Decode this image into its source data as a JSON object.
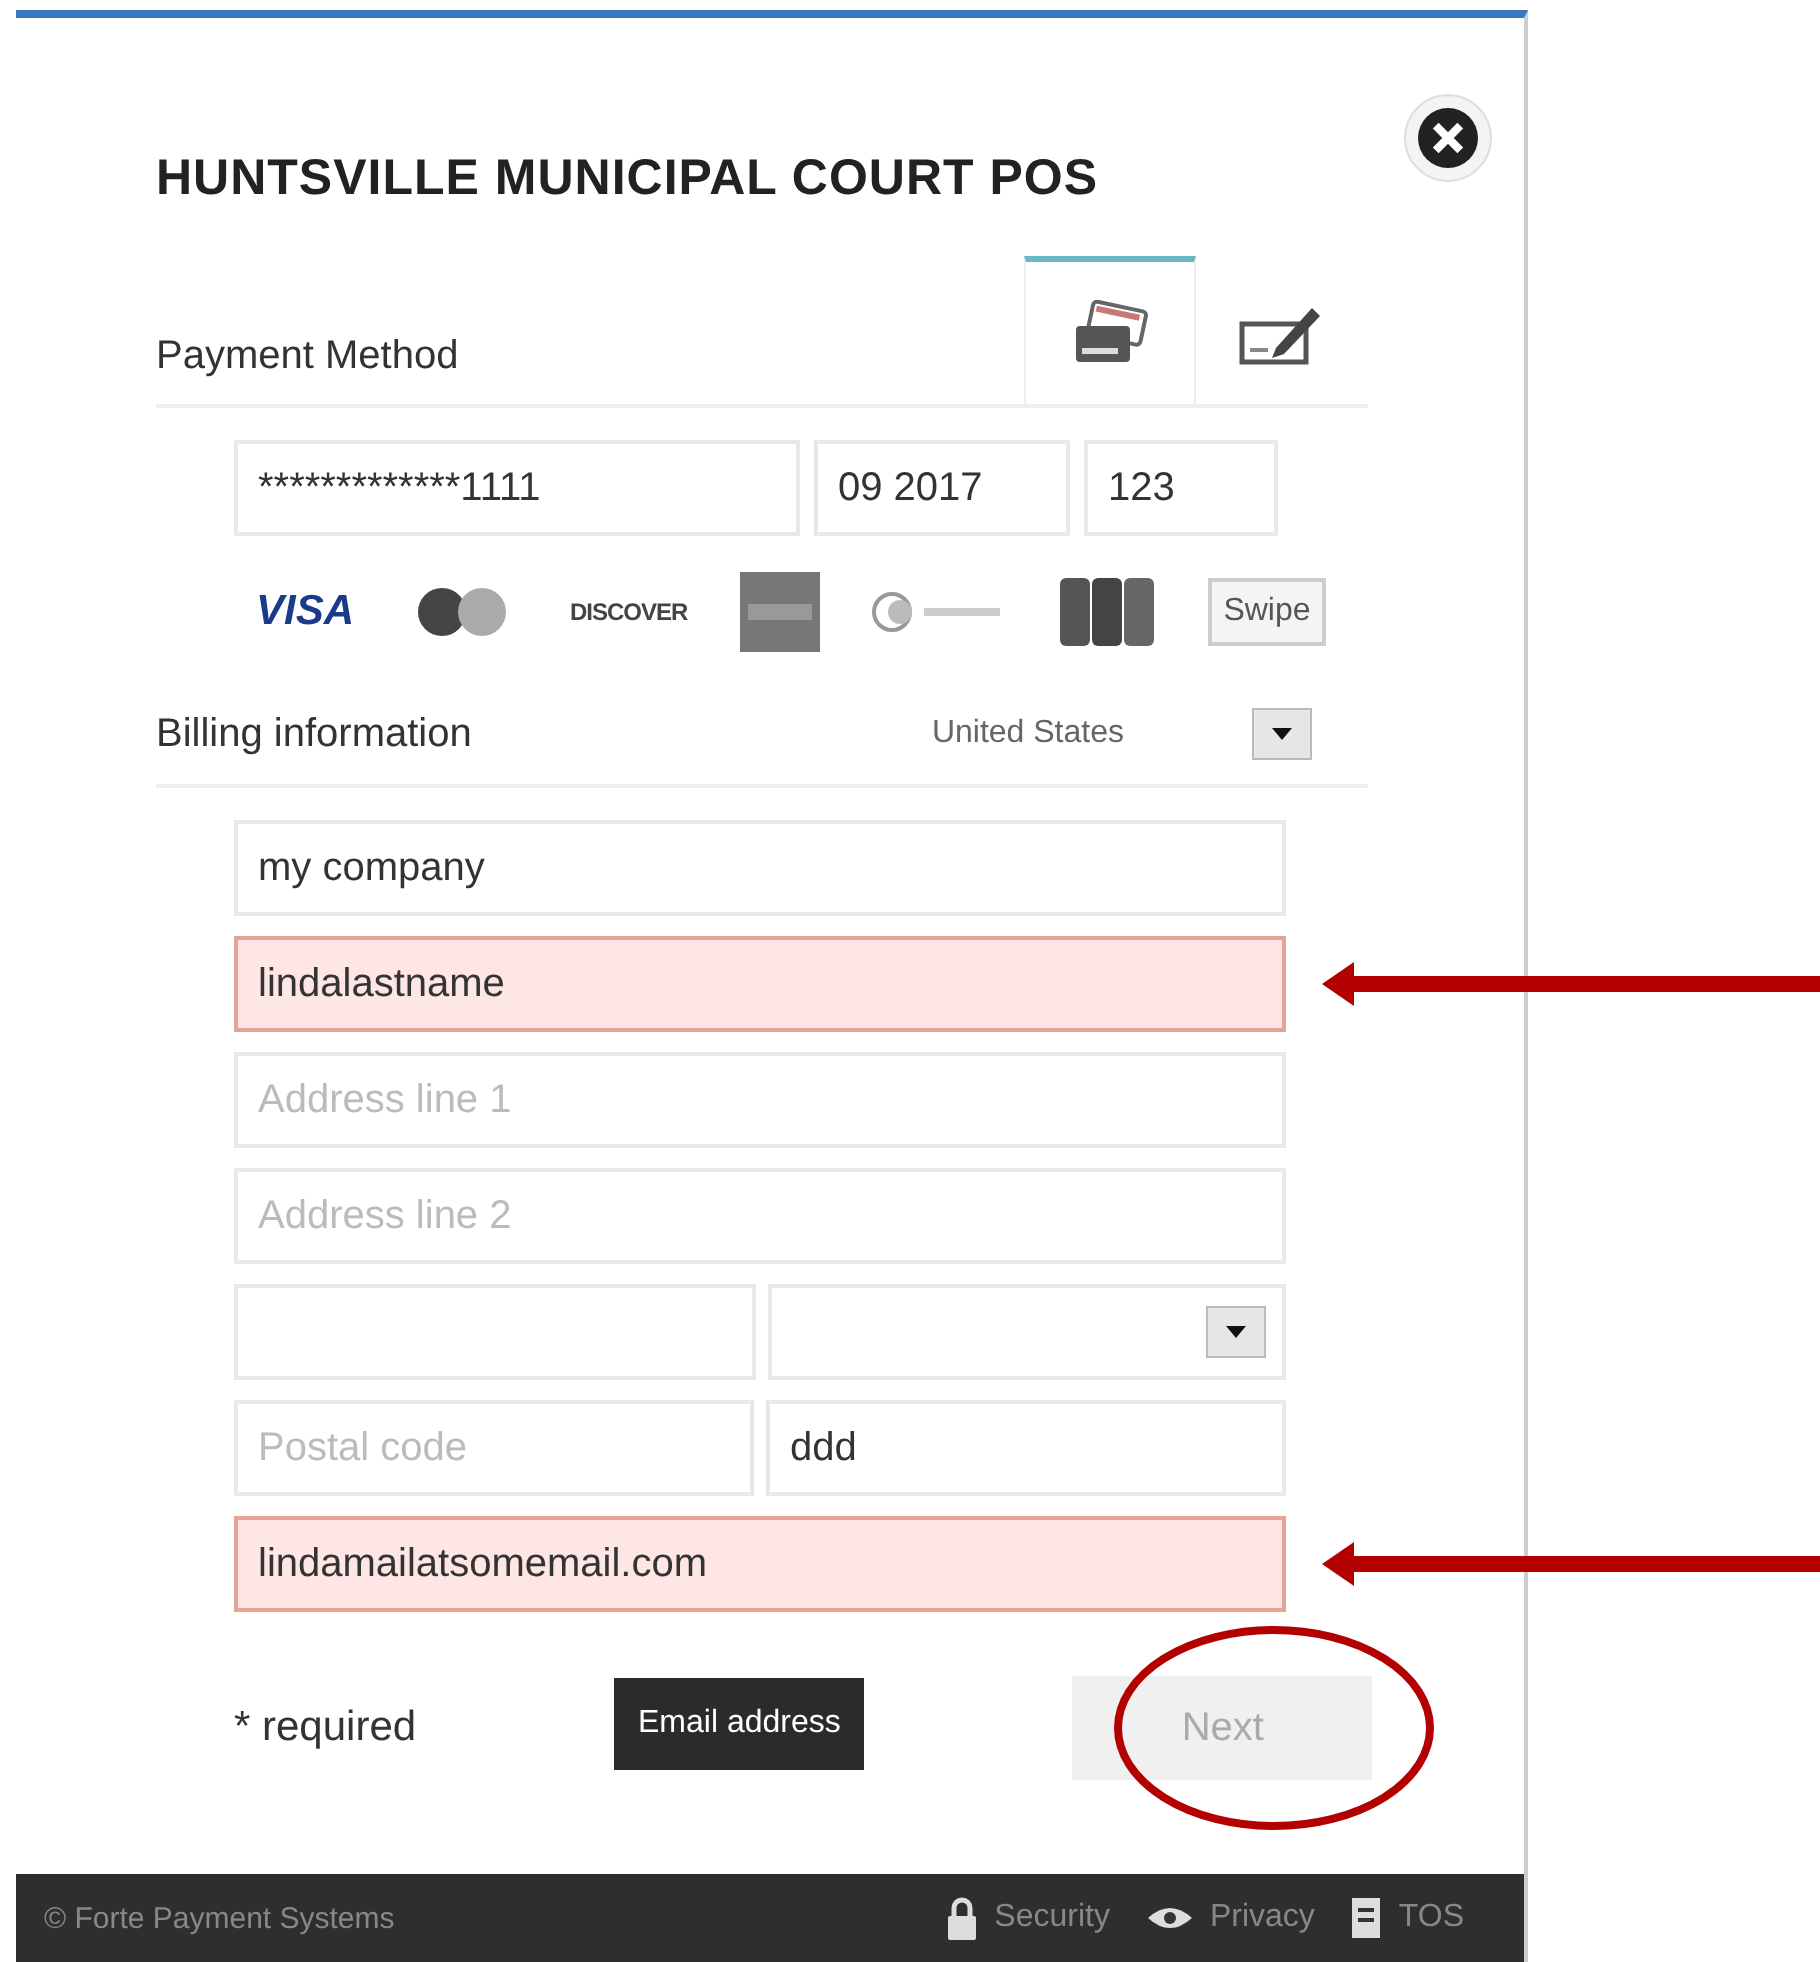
{
  "title": "HUNTSVILLE MUNICIPAL COURT POS",
  "payment_method": {
    "label": "Payment Method",
    "tabs": [
      {
        "kind": "card",
        "selected": true
      },
      {
        "kind": "check",
        "selected": false
      }
    ]
  },
  "card": {
    "number": "*************1111",
    "expiry": "09 2017",
    "cvv": "123"
  },
  "brands": [
    {
      "kind": "visa",
      "label": "VISA"
    },
    {
      "kind": "mastercard"
    },
    {
      "kind": "discover",
      "label": "DISCOVER"
    },
    {
      "kind": "amex"
    },
    {
      "kind": "diners"
    },
    {
      "kind": "jcb"
    }
  ],
  "swipe": "Swipe",
  "billing": {
    "label": "Billing information",
    "country": "United States"
  },
  "rows": [
    {
      "arrow": false,
      "fields": [
        {
          "kind": "text",
          "value": "my company",
          "invalid": false
        }
      ]
    },
    {
      "arrow": true,
      "fields": [
        {
          "kind": "text",
          "value": "lindalastname",
          "invalid": true
        }
      ]
    },
    {
      "arrow": false,
      "fields": [
        {
          "kind": "text",
          "placeholder": "Address line 1",
          "invalid": false
        }
      ]
    },
    {
      "arrow": false,
      "fields": [
        {
          "kind": "text",
          "placeholder": "Address line 2",
          "invalid": false
        }
      ]
    },
    {
      "arrow": false,
      "fields": [
        {
          "kind": "text",
          "invalid": false
        },
        {
          "kind": "select",
          "invalid": false
        }
      ]
    },
    {
      "arrow": false,
      "fields": [
        {
          "kind": "text",
          "placeholder": "Postal code",
          "invalid": false
        },
        {
          "kind": "text",
          "value": "ddd",
          "invalid": false
        }
      ]
    },
    {
      "arrow": true,
      "fields": [
        {
          "kind": "text",
          "value": "lindamailatsomemail.com",
          "invalid": true
        }
      ]
    }
  ],
  "tooltip": "Email address",
  "required_note": "* required",
  "next": {
    "label": "Next",
    "disabled": true,
    "circled": true
  },
  "footer": {
    "copyright": "© Forte Payment Systems",
    "links": [
      {
        "kind": "lock",
        "label": "Security"
      },
      {
        "kind": "eye",
        "label": "Privacy"
      },
      {
        "kind": "document",
        "label": "TOS"
      }
    ]
  }
}
